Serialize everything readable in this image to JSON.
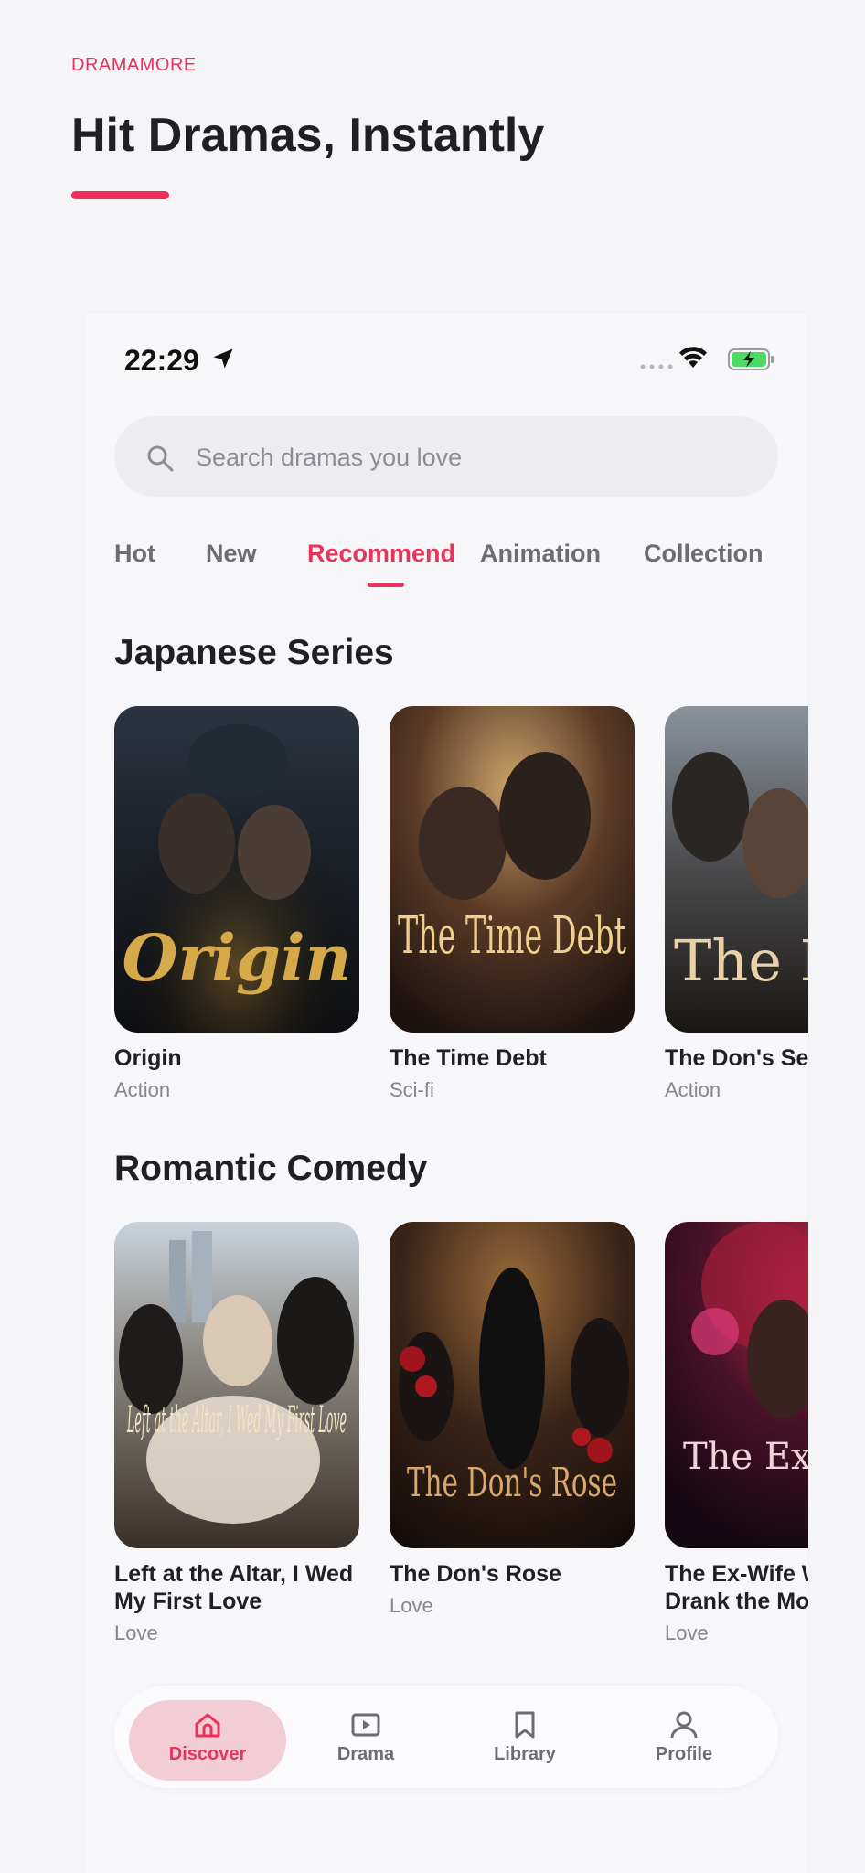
{
  "header": {
    "brand": "DRAMAMORE",
    "headline": "Hit Dramas, Instantly"
  },
  "status_bar": {
    "time": "22:29"
  },
  "search": {
    "placeholder": "Search dramas you love"
  },
  "tabs": [
    {
      "label": "Hot"
    },
    {
      "label": "New"
    },
    {
      "label": "Recommend",
      "active": true
    },
    {
      "label": "Animation"
    },
    {
      "label": "Collection"
    }
  ],
  "sections": [
    {
      "title": "Japanese Series",
      "items": [
        {
          "title": "Origin",
          "genre": "Action",
          "poster_text": "Origin"
        },
        {
          "title": "The Time Debt",
          "genre": "Sci-fi",
          "poster_text": "The Time Debt"
        },
        {
          "title": "The Don's Secret",
          "genre": "Action",
          "poster_text": "The Don's Secret"
        }
      ]
    },
    {
      "title": "Romantic Comedy",
      "items": [
        {
          "title": "Left at the Altar, I Wed My First Love",
          "genre": "Love",
          "poster_text": "Left at the Altar, I Wed My First Love"
        },
        {
          "title": "The Don's Rose",
          "genre": "Love",
          "poster_text": "The Don's Rose"
        },
        {
          "title": "The Ex-Wife Who Drank the Moon",
          "genre": "Love",
          "poster_text": "The Ex-Wife Who Drank the Moon"
        }
      ]
    }
  ],
  "nav": [
    {
      "label": "Discover",
      "icon": "home-icon",
      "active": true
    },
    {
      "label": "Drama",
      "icon": "play-icon"
    },
    {
      "label": "Library",
      "icon": "bookmark-icon"
    },
    {
      "label": "Profile",
      "icon": "person-icon"
    }
  ],
  "colors": {
    "accent": "#e8345a",
    "background": "#f5f5f8",
    "nav_active_bg": "#f3cdd5"
  }
}
